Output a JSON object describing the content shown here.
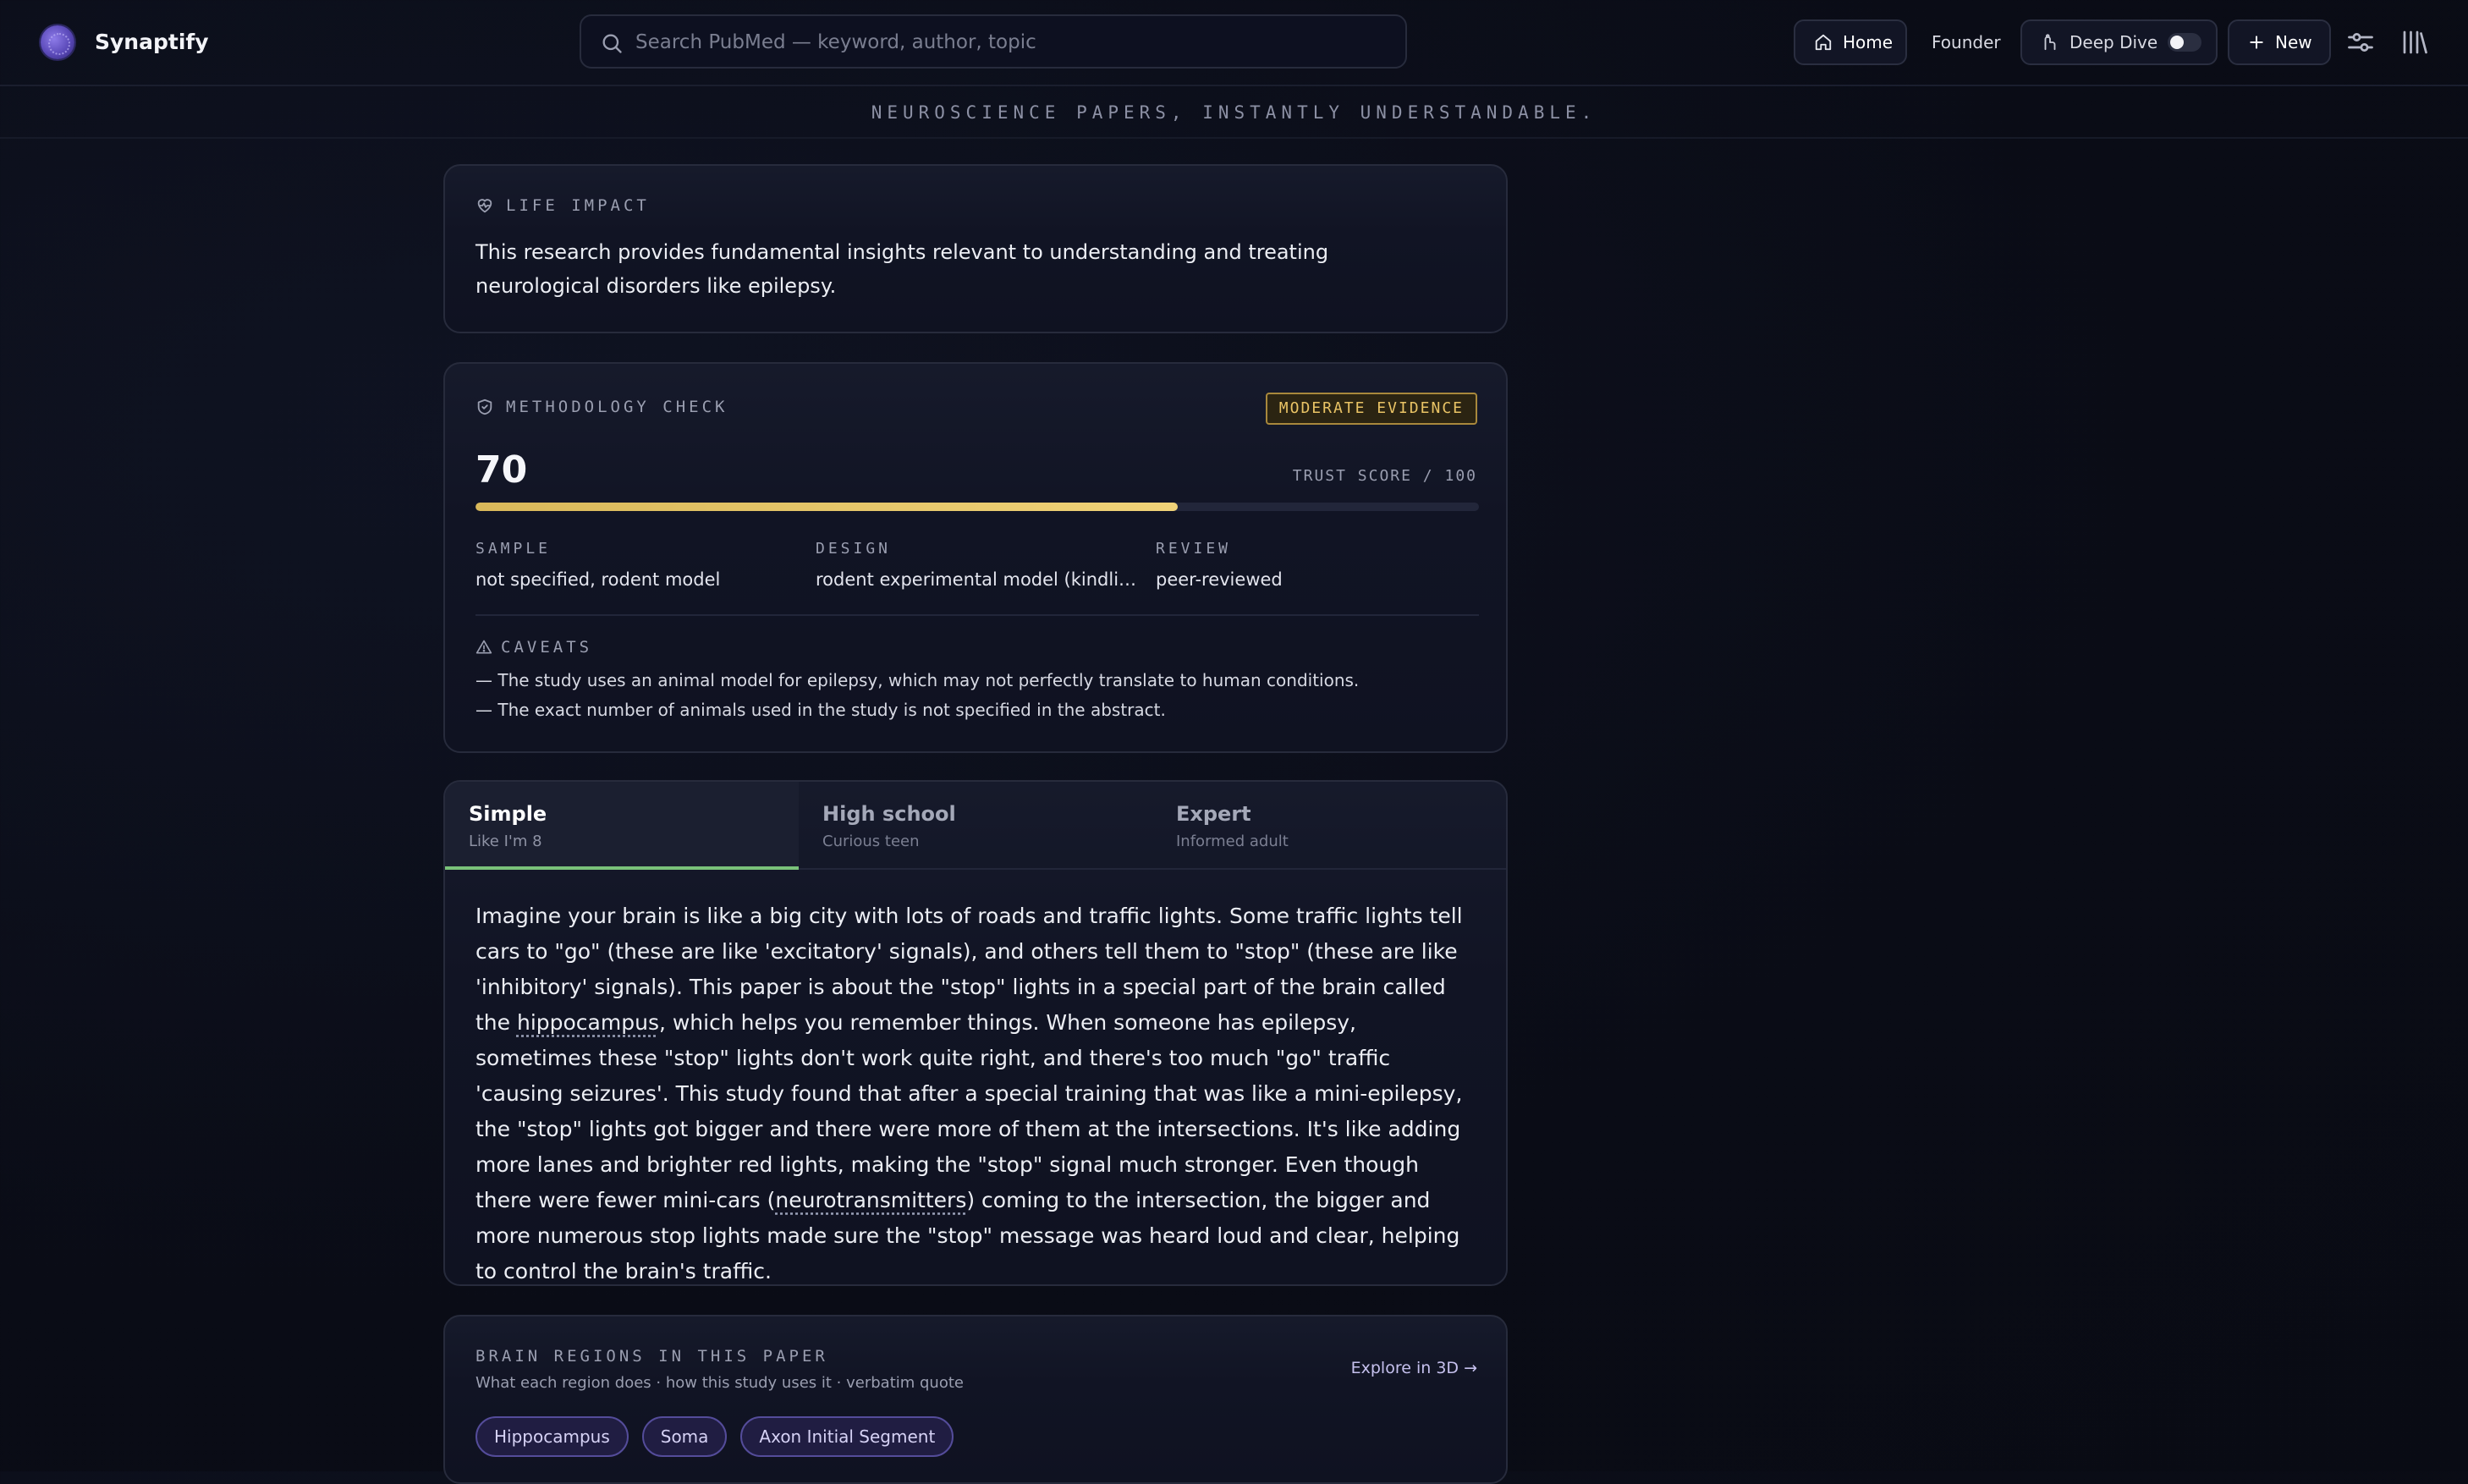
{
  "app": {
    "name": "Synaptify"
  },
  "search": {
    "placeholder": "Search PubMed — keyword, author, topic"
  },
  "nav": {
    "home": "Home",
    "founder": "Founder",
    "deep_dive": "Deep Dive",
    "deep_dive_enabled": false,
    "new": "New"
  },
  "tagline": "NEUROSCIENCE PAPERS, INSTANTLY UNDERSTANDABLE.",
  "life_impact": {
    "label": "LIFE IMPACT",
    "text": "This research provides fundamental insights relevant to understanding and treating neurological disorders like epilepsy."
  },
  "methodology": {
    "label": "METHODOLOGY CHECK",
    "badge": "MODERATE EVIDENCE",
    "score": "70",
    "score_value": 70,
    "score_max": 100,
    "trust_label": "TRUST SCORE / 100",
    "stats": [
      {
        "key": "SAMPLE",
        "value": "not specified, rodent model"
      },
      {
        "key": "DESIGN",
        "value": "rodent experimental model (kindling), ..."
      },
      {
        "key": "REVIEW",
        "value": "peer-reviewed"
      }
    ],
    "caveats_label": "CAVEATS",
    "caveats": [
      "— The study uses an animal model for epilepsy, which may not perfectly translate to human conditions.",
      "— The exact number of animals used in the study is not specified in the abstract."
    ],
    "colors": {
      "bar": "#e6c66a",
      "badge_border": "#a8883c"
    }
  },
  "levels": {
    "tabs": [
      {
        "title": "Simple",
        "subtitle": "Like I'm 8",
        "active": true
      },
      {
        "title": "High school",
        "subtitle": "Curious teen",
        "active": false
      },
      {
        "title": "Expert",
        "subtitle": "Informed adult",
        "active": false
      }
    ],
    "explanation": {
      "p1": "Imagine your brain is like a big city with lots of roads and traffic lights. Some traffic lights tell cars to \"go\" (these are like 'excitatory' signals), and others tell them to \"stop\" (these are like 'inhibitory' signals). This paper is about the \"stop\" lights in a special part of the brain called the ",
      "term1": "hippocampus",
      "p2": ", which helps you remember things. When someone has epilepsy, sometimes these \"stop\" lights don't work quite right, and there's too much \"go\" traffic 'causing seizures'. This study found that after a special training that was like a mini-epilepsy, the \"stop\" lights got bigger and there were more of them at the intersections. It's like adding more lanes and brighter red lights, making the \"stop\" signal much stronger. Even though there were fewer mini-cars (",
      "term2": "neurotransmitters",
      "p3": ") coming to the intersection, the bigger and more numerous stop lights made sure the \"stop\" message was heard loud and clear, helping to control the brain's traffic."
    },
    "accent": "#7ac27a"
  },
  "regions": {
    "label": "BRAIN REGIONS IN THIS PAPER",
    "subtitle": "What each region does · how this study uses it · verbatim quote",
    "explore": "Explore in 3D →",
    "chips": [
      "Hippocampus",
      "Soma",
      "Axon Initial Segment"
    ]
  }
}
